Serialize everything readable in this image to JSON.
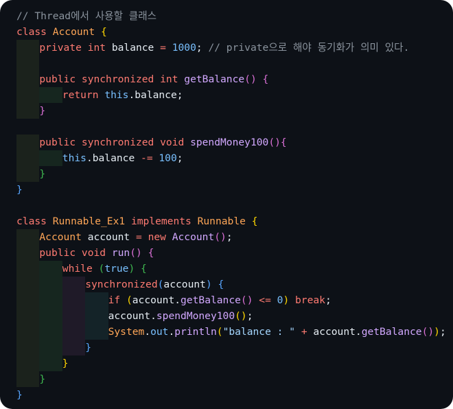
{
  "editor": {
    "lines": [
      [
        [
          "cm",
          "// Thread에서 사용할 클래스"
        ]
      ],
      [
        [
          "kw",
          "class "
        ],
        [
          "ty",
          "Account "
        ],
        [
          "b1",
          "{"
        ]
      ],
      [
        [
          "kw",
          "private "
        ],
        [
          "kw",
          "int "
        ],
        [
          "pl",
          "balance "
        ],
        [
          "op",
          "= "
        ],
        [
          "nm",
          "1000"
        ],
        [
          "pl",
          "; "
        ],
        [
          "cm",
          "// private으로 해야 동기화가 의미 있다."
        ]
      ],
      [],
      [
        [
          "kw",
          "public "
        ],
        [
          "kw",
          "synchronized "
        ],
        [
          "kw",
          "int "
        ],
        [
          "fn",
          "getBalance"
        ],
        [
          "b2",
          "() "
        ],
        [
          "b2",
          "{"
        ]
      ],
      [
        [
          "kw",
          "return "
        ],
        [
          "nm",
          "this"
        ],
        [
          "pl",
          ".balance;"
        ]
      ],
      [
        [
          "b2",
          "}"
        ]
      ],
      [],
      [
        [
          "kw",
          "public "
        ],
        [
          "kw",
          "synchronized "
        ],
        [
          "kw",
          "void "
        ],
        [
          "fn",
          "spendMoney100"
        ],
        [
          "b2",
          "()"
        ],
        [
          "b2",
          "{"
        ]
      ],
      [
        [
          "nm",
          "this"
        ],
        [
          "pl",
          ".balance "
        ],
        [
          "op",
          "-= "
        ],
        [
          "nm",
          "100"
        ],
        [
          "pl",
          ";"
        ]
      ],
      [
        [
          "b3",
          "}"
        ]
      ],
      [
        [
          "b4",
          "}"
        ]
      ],
      [],
      [
        [
          "kw",
          "class "
        ],
        [
          "ty",
          "Runnable_Ex1 "
        ],
        [
          "kw",
          "implements "
        ],
        [
          "ty",
          "Runnable "
        ],
        [
          "b1",
          "{"
        ]
      ],
      [
        [
          "ty",
          "Account "
        ],
        [
          "pl",
          "account "
        ],
        [
          "op",
          "= "
        ],
        [
          "kw",
          "new "
        ],
        [
          "fn",
          "Account"
        ],
        [
          "b2",
          "()"
        ],
        [
          "pl",
          ";"
        ]
      ],
      [
        [
          "kw",
          "public "
        ],
        [
          "kw",
          "void "
        ],
        [
          "fn",
          "run"
        ],
        [
          "b2",
          "() "
        ],
        [
          "b2",
          "{"
        ]
      ],
      [
        [
          "kw",
          "while "
        ],
        [
          "b3",
          "("
        ],
        [
          "nm",
          "true"
        ],
        [
          "b3",
          ") "
        ],
        [
          "b3",
          "{"
        ]
      ],
      [
        [
          "kw",
          "synchronized"
        ],
        [
          "b4",
          "("
        ],
        [
          "pl",
          "account"
        ],
        [
          "b4",
          ") "
        ],
        [
          "b4",
          "{"
        ]
      ],
      [
        [
          "kw",
          "if "
        ],
        [
          "b1",
          "("
        ],
        [
          "pl",
          "account."
        ],
        [
          "fn",
          "getBalance"
        ],
        [
          "b2",
          "() "
        ],
        [
          "op",
          "<= "
        ],
        [
          "nm",
          "0"
        ],
        [
          "b1",
          ") "
        ],
        [
          "kw",
          "break"
        ],
        [
          "pl",
          ";"
        ]
      ],
      [
        [
          "pl",
          "account."
        ],
        [
          "fn",
          "spendMoney100"
        ],
        [
          "b1",
          "()"
        ],
        [
          "pl",
          ";"
        ]
      ],
      [
        [
          "ty",
          "System"
        ],
        [
          "pl",
          "."
        ],
        [
          "nm",
          "out"
        ],
        [
          "pl",
          "."
        ],
        [
          "fn",
          "println"
        ],
        [
          "b1",
          "("
        ],
        [
          "st",
          "\"balance : \" "
        ],
        [
          "op",
          "+ "
        ],
        [
          "pl",
          "account."
        ],
        [
          "fn",
          "getBalance"
        ],
        [
          "b2",
          "()"
        ],
        [
          "b1",
          ")"
        ],
        [
          "pl",
          ";"
        ]
      ],
      [
        [
          "b4",
          "}"
        ]
      ],
      [
        [
          "b1",
          "}"
        ]
      ],
      [
        [
          "b3",
          "}"
        ]
      ],
      [
        [
          "b4",
          "}"
        ]
      ]
    ]
  }
}
